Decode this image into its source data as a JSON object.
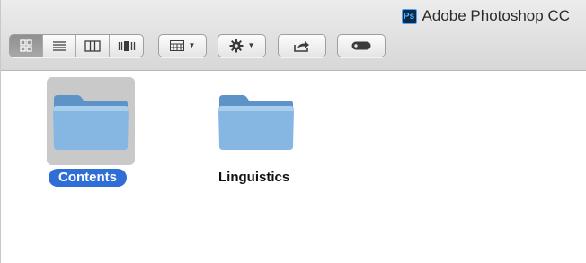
{
  "window": {
    "title": "Adobe Photoshop CC",
    "title_icon_text": "Ps"
  },
  "toolbar": {
    "view_modes": [
      {
        "name": "icon-view",
        "icon": "icon-grid-icon",
        "active": true
      },
      {
        "name": "list-view",
        "icon": "list-lines-icon",
        "active": false
      },
      {
        "name": "column-view",
        "icon": "columns-icon",
        "active": false
      },
      {
        "name": "coverflow-view",
        "icon": "coverflow-icon",
        "active": false
      }
    ],
    "arrange_icon": "arrange-grid-icon",
    "action_icon": "gear-icon",
    "share_icon": "share-icon",
    "tags_icon": "tag-pill-icon"
  },
  "files": [
    {
      "name": "Contents",
      "selected": true
    },
    {
      "name": "Linguistics",
      "selected": false
    }
  ],
  "colors": {
    "selection_label": "#2f6ed6",
    "folder_blue": "#7fb3e0"
  }
}
